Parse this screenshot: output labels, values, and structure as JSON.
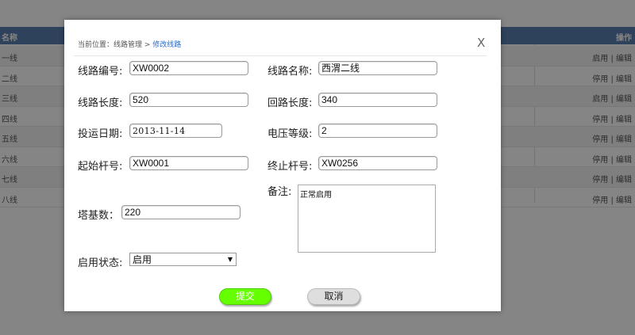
{
  "background": {
    "header": {
      "name_col": "名称",
      "op_col": "操作"
    },
    "rows": [
      {
        "name": "一线",
        "ops": "启用 | 编辑"
      },
      {
        "name": "二线",
        "ops": "停用 | 编辑"
      },
      {
        "name": "三线",
        "ops": "启用 | 编辑"
      },
      {
        "name": "四线",
        "ops": "停用 | 编辑"
      },
      {
        "name": "五线",
        "ops": "停用 | 编辑"
      },
      {
        "name": "六线",
        "ops": "停用 | 编辑"
      },
      {
        "name": "七线",
        "ops": "停用 | 编辑"
      },
      {
        "name": "八线",
        "ops": "停用 | 编辑"
      }
    ]
  },
  "modal": {
    "breadcrumb": {
      "prefix": "当前位置：",
      "parent": "线路管理",
      "separator": " > ",
      "current": "修改线路"
    },
    "close_label": "X",
    "fields": {
      "line_code": {
        "label": "线路编号:",
        "value": "XW0002"
      },
      "line_name": {
        "label": "线路名称:",
        "value": "西渭二线"
      },
      "line_length": {
        "label": "线路长度:",
        "value": "520"
      },
      "loop_length": {
        "label": "回路长度:",
        "value": "340"
      },
      "commission_date": {
        "label": "投运日期:",
        "value": "2013-11-14"
      },
      "voltage_level": {
        "label": "电压等级:",
        "value": "2"
      },
      "start_pole": {
        "label": "起始杆号:",
        "value": "XW0001"
      },
      "end_pole": {
        "label": "终止杆号:",
        "value": "XW0256"
      },
      "tower_count": {
        "label": "塔基数：",
        "value": "220"
      },
      "remarks": {
        "label": "备注:",
        "value": "正常启用"
      },
      "status": {
        "label": "启用状态:",
        "value": "启用"
      }
    },
    "buttons": {
      "submit": "提交",
      "cancel": "取消"
    }
  },
  "colors": {
    "header_bg": "#5b7fae",
    "submit_bg": "#66ff00",
    "breadcrumb_current": "#2a6cc7"
  }
}
